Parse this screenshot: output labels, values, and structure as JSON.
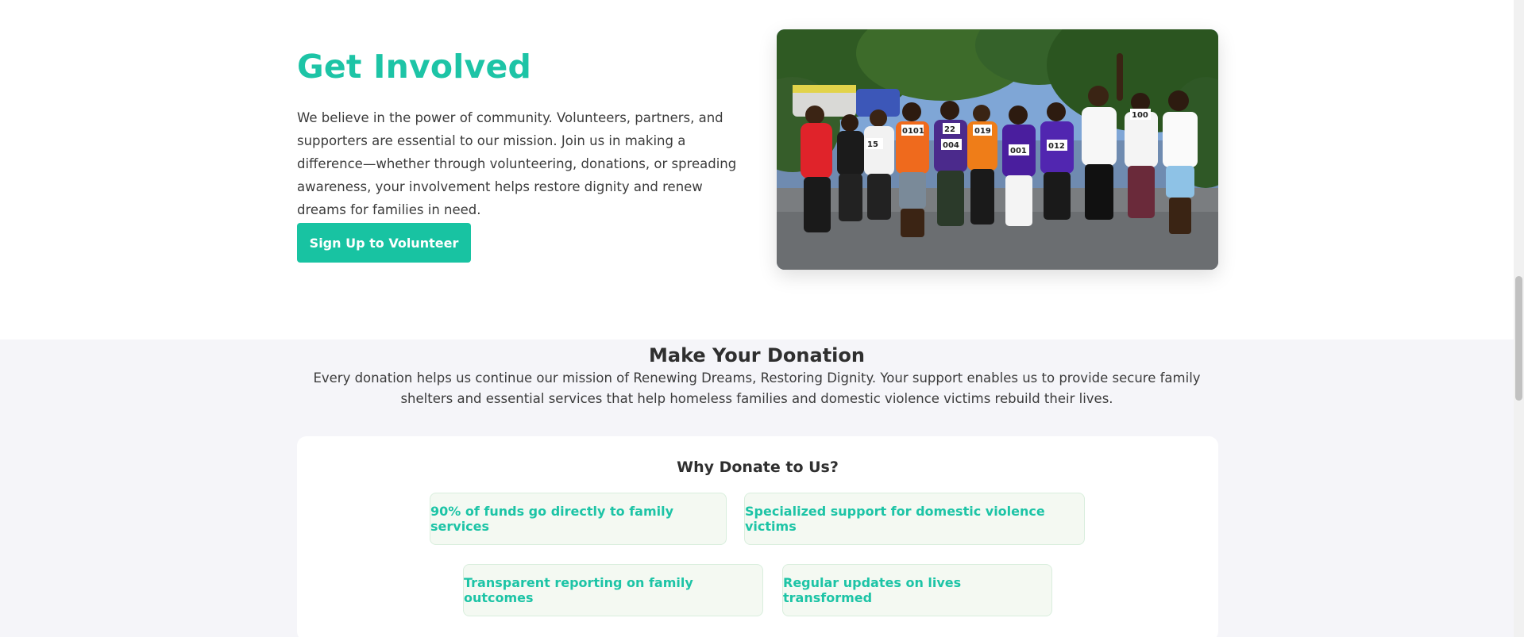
{
  "involved": {
    "title": "Get Involved",
    "text": "We believe in the power of community. Volunteers, partners, and supporters are essential to our mission. Join us in making a difference—whether through volunteering, donations, or spreading awareness, your involvement helps restore dignity and renew dreams for families in need.",
    "button_label": "Sign Up to Volunteer",
    "photo_bibs": [
      "15",
      "0101",
      "22",
      "004",
      "019",
      "001",
      "012",
      "100"
    ]
  },
  "donation": {
    "title": "Make Your Donation",
    "text": "Every donation helps us continue our mission of Renewing Dreams, Restoring Dignity. Your support enables us to provide secure family shelters and essential services that help homeless families and domestic violence victims rebuild their lives.",
    "why_title": "Why Donate to Us?",
    "reasons": [
      "90% of funds go directly to family services",
      "Specialized support for domestic violence victims",
      "Transparent reporting on family outcomes",
      "Regular updates on lives transformed"
    ]
  },
  "colors": {
    "accent": "#1dc4a6",
    "button": "#18c3a2",
    "section_bg": "#f5f5f9",
    "reason_bg": "#f4f9f2"
  }
}
